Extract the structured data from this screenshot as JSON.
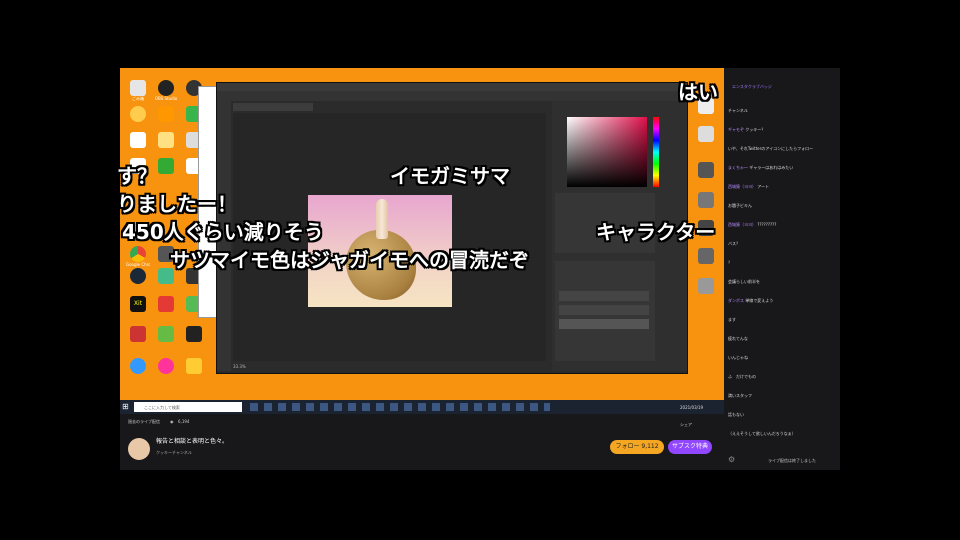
{
  "overlay": {
    "hai": "はい",
    "line_su": "す？",
    "imogami": "イモガミサマ",
    "arimashita": "りましたー！",
    "l450": "450人ぐらい減りそう",
    "chara": "キャラクター",
    "satsuma": "サツマイモ色はジャガイモへの冒涜だぞ"
  },
  "colors": {
    "orange": "#f7930f",
    "follow": "#f5a623",
    "subscribe": "#9146ff",
    "chat_bg": "#18181b"
  },
  "stream": {
    "past_label": "過去のライブ配信",
    "viewers": "6,194",
    "title": "報告と相談と表明と色々。",
    "channel": "クッキーチャンネル",
    "follow": "フォロー",
    "subscribe": "サブスク特典",
    "share": "シェア",
    "follow_count": "9,112"
  },
  "chat": {
    "header": "エンスタクラブバッジ",
    "footer": "ライブ配信は終了しました",
    "messages": [
      {
        "user": "",
        "text": "チャンネル"
      },
      {
        "user": "ギャモぞ",
        "text": "クッキー？"
      },
      {
        "user": "",
        "text": "いや、それTwitterのアイコンにしたらフォロー"
      },
      {
        "user": "まくちゃ～",
        "text": "ギャラーはあれはみたい"
      },
      {
        "user": "西城猿（ヨヨ）",
        "text": "アート"
      },
      {
        "user": "",
        "text": "お題子ビキん"
      },
      {
        "user": "西城猿（ヨヨ）",
        "text": "?????????"
      },
      {
        "user": "",
        "text": "バス？"
      },
      {
        "user": "",
        "text": "？"
      },
      {
        "user": "",
        "text": "会議らしい前半を"
      },
      {
        "user": "ダンボス",
        "text": "単線で変えよう"
      },
      {
        "user": "",
        "text": "ます"
      },
      {
        "user": "",
        "text": "疲れてんな"
      },
      {
        "user": "",
        "text": "いんじゃね"
      },
      {
        "user": "",
        "text": "ふ　だけでもの"
      },
      {
        "user": "",
        "text": "満いスタッフ"
      },
      {
        "user": "",
        "text": "話もない"
      },
      {
        "user": "",
        "text": "（ええそうして欲しいんだろうなぁ）"
      }
    ]
  },
  "desktop_icons": [
    "ごみ箱",
    "OBS Studio",
    "",
    "",
    "",
    "",
    "",
    "",
    "",
    "",
    "Google Chrome",
    "",
    "",
    "",
    "",
    "",
    "",
    "",
    "",
    "",
    "",
    "",
    "",
    "",
    "",
    "",
    "Xit"
  ],
  "taskbar": {
    "search": "ここに入力して検索",
    "clock": "2021/03/19"
  },
  "photoshop": {
    "zoom": "33.3%"
  }
}
